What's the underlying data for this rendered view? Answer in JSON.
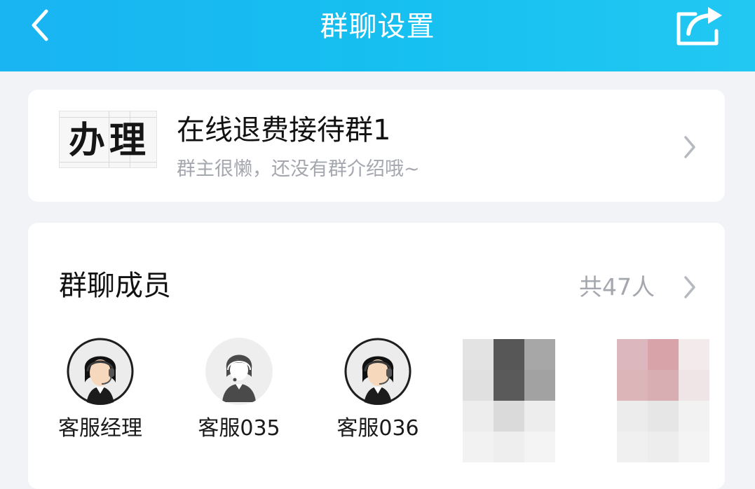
{
  "header": {
    "title": "群聊设置",
    "back_icon": "chevron-left-icon",
    "share_icon": "share-icon"
  },
  "group": {
    "avatar_text": "办理",
    "name": "在线退费接待群1",
    "intro": "群主很懒，还没有群介绍哦~"
  },
  "members": {
    "title": "群聊成员",
    "count_label": "共47人",
    "list": [
      {
        "name": "客服经理",
        "avatar": "headset-agent-avatar"
      },
      {
        "name": "客服035",
        "avatar": "default-agent-avatar"
      },
      {
        "name": "客服036",
        "avatar": "headset-agent-avatar"
      }
    ],
    "blurred_avatars": 2
  },
  "colors": {
    "header_start": "#19b4f2",
    "header_end": "#22c8f2",
    "page_bg": "#f2f3f7",
    "secondary_text": "#a4a7ae"
  }
}
